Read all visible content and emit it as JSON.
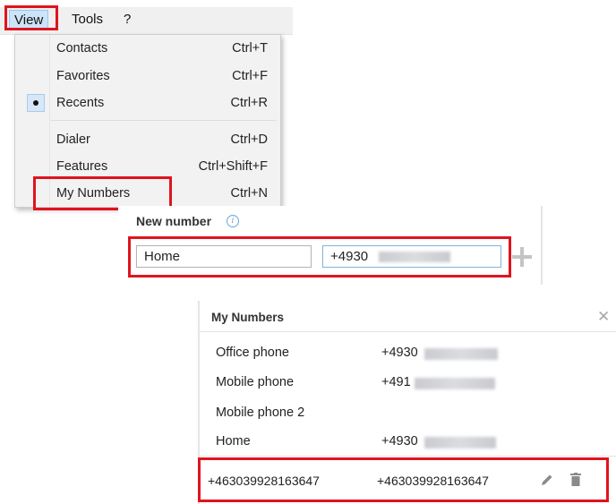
{
  "menubar": {
    "items": [
      {
        "label": "View"
      },
      {
        "label": "Tools"
      },
      {
        "label": "?"
      }
    ]
  },
  "view_menu": {
    "items": [
      {
        "label": "Contacts",
        "shortcut": "Ctrl+T"
      },
      {
        "label": "Favorites",
        "shortcut": "Ctrl+F"
      },
      {
        "label": "Recents",
        "shortcut": "Ctrl+R",
        "checked": true
      },
      {
        "label": "Dialer",
        "shortcut": "Ctrl+D"
      },
      {
        "label": "Features",
        "shortcut": "Ctrl+Shift+F"
      },
      {
        "label": "My Numbers",
        "shortcut": "Ctrl+N"
      }
    ]
  },
  "new_number": {
    "title": "New number",
    "name_value": "Home",
    "number_value": "+4930"
  },
  "my_numbers": {
    "title": "My Numbers",
    "rows": [
      {
        "name": "Office phone",
        "number": "+4930"
      },
      {
        "name": "Mobile phone",
        "number": "+491"
      },
      {
        "name": "Mobile phone 2",
        "number": ""
      },
      {
        "name": "Home",
        "number": "+4930"
      }
    ],
    "new_row": {
      "name": "+463039928163647",
      "number": "+463039928163647"
    }
  },
  "colors": {
    "highlight": "#e0141e",
    "menu_background": "#f0f0f0",
    "selected_menu": "#cce4f7",
    "info_icon": "#6aa7d8"
  },
  "icons": [
    "info-icon",
    "plus-icon",
    "close-icon",
    "edit-icon",
    "trash-icon",
    "check-dot-icon"
  ]
}
